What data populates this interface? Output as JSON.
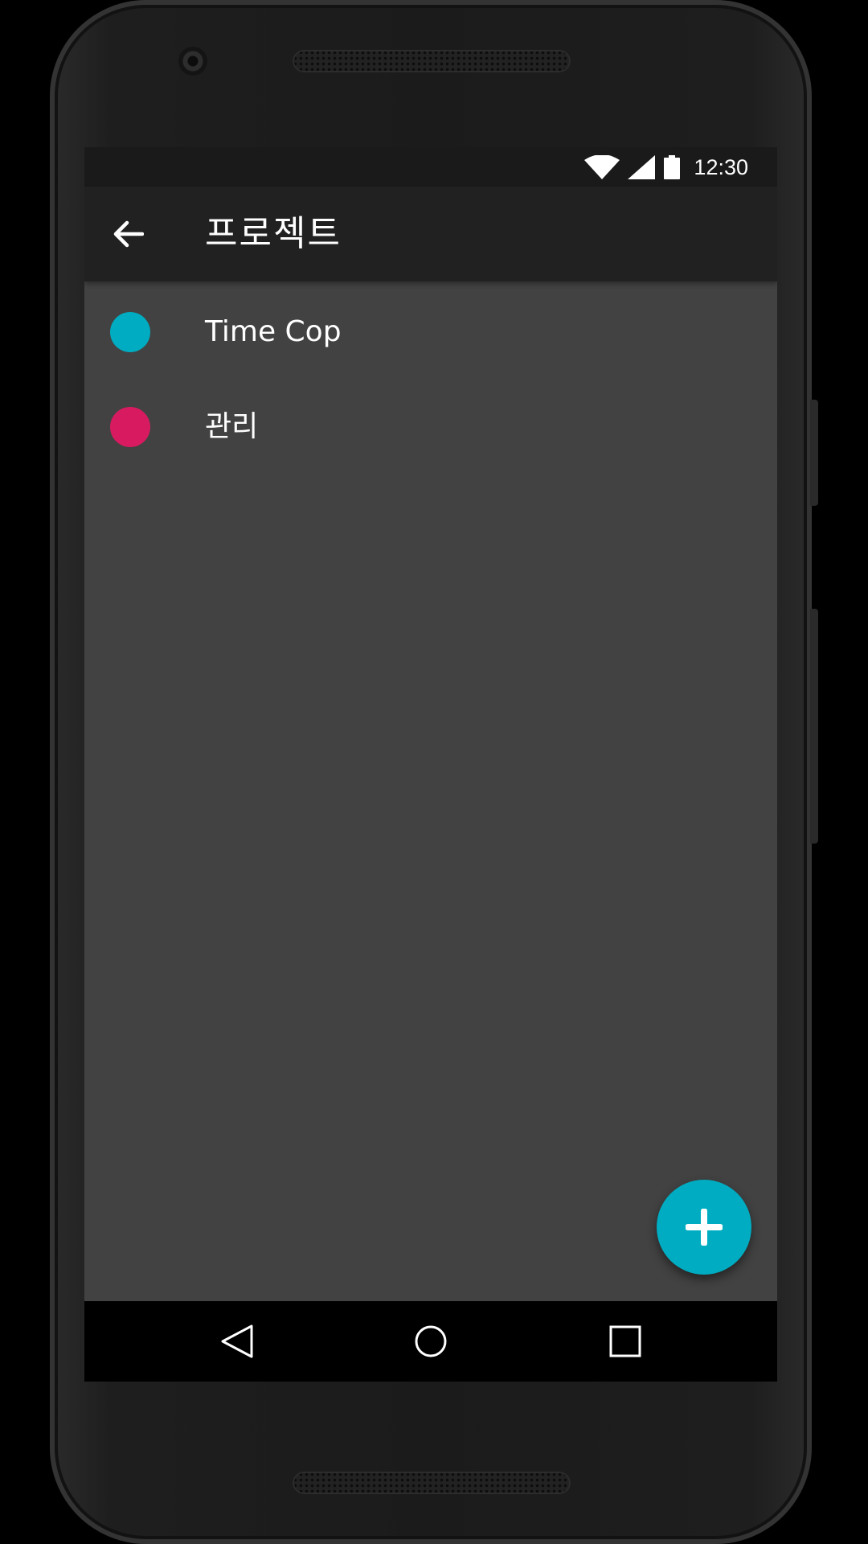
{
  "status_bar": {
    "time": "12:30",
    "icons": [
      "wifi-icon",
      "cellular-signal-icon",
      "battery-icon"
    ]
  },
  "app_bar": {
    "title": "프로젝트",
    "back_icon": "arrow-back-icon"
  },
  "projects": [
    {
      "name": "Time Cop",
      "color": "#00acc1"
    },
    {
      "name": "관리",
      "color": "#d81b60"
    }
  ],
  "fab": {
    "icon": "plus-icon",
    "color": "#00acc1"
  },
  "nav_bar": {
    "icons": [
      "back-triangle-icon",
      "home-circle-icon",
      "recents-square-icon"
    ]
  },
  "colors": {
    "screen_background": "#424242",
    "app_bar": "#212121",
    "status_bar": "#1a1a1a"
  }
}
